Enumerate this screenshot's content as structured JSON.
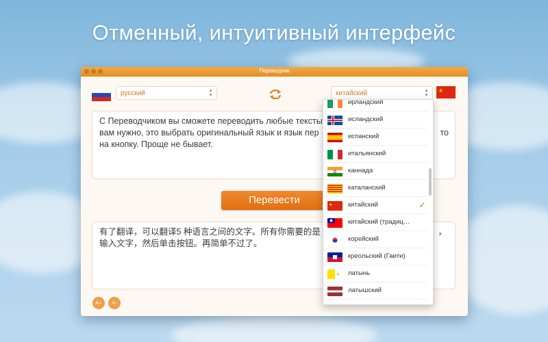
{
  "headline": "Отменный, интуитивный интерфейс",
  "window": {
    "title": "Переводчик",
    "source_language": "русский",
    "target_language": "китайский",
    "source_text": "С Переводчиком вы сможете переводить любые тексты",
    "source_text_line2": "вам нужно, это выбрать оригинальный язык и язык пер",
    "source_text_tail": "то",
    "source_text_line3": "на кнопку. Проще не бывает.",
    "translate_label": "Перевести",
    "output_text_line1": "有了翻译，可以翻译5 种语言之间的文字。所有你需要的是",
    "output_text_tail": "，",
    "output_text_line2": "输入文字，然后单击按钮。再简单不过了。",
    "font_increase": "A+",
    "font_decrease": "A-"
  },
  "dropdown": {
    "selected": "китайский",
    "items": [
      {
        "label": "ирландский",
        "flag": "ireland"
      },
      {
        "label": "исландский",
        "flag": "iceland"
      },
      {
        "label": "испанский",
        "flag": "spain"
      },
      {
        "label": "итальянский",
        "flag": "italy"
      },
      {
        "label": "каннада",
        "flag": "india"
      },
      {
        "label": "каталанский",
        "flag": "catalonia"
      },
      {
        "label": "китайский",
        "flag": "china"
      },
      {
        "label": "китайский (традиц…",
        "flag": "taiwan"
      },
      {
        "label": "корейский",
        "flag": "korea"
      },
      {
        "label": "креольский (Гаити)",
        "flag": "haiti"
      },
      {
        "label": "латынь",
        "flag": "vatican"
      },
      {
        "label": "латышский",
        "flag": "latvia"
      }
    ]
  },
  "colors": {
    "accent": "#e57a1c",
    "titlebar": "#ea9a31",
    "selected_text": "#d9771c"
  }
}
